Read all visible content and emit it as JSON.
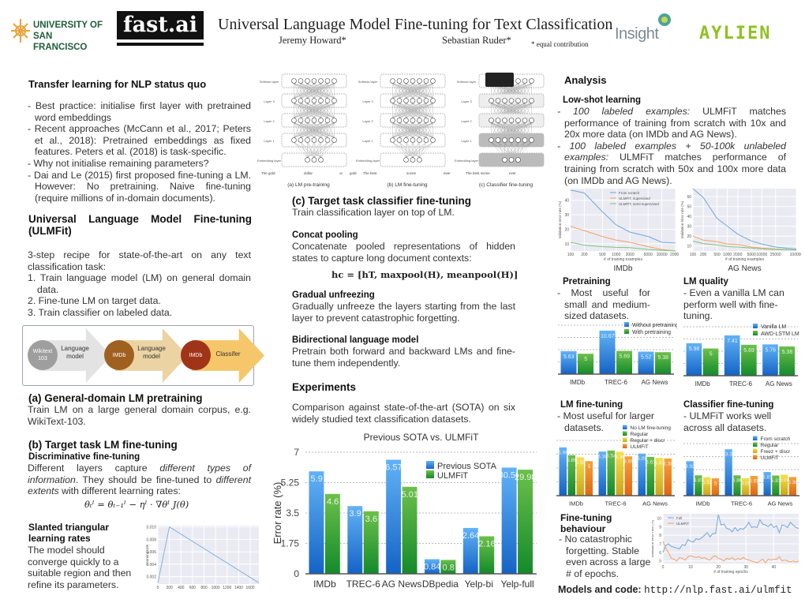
{
  "header": {
    "title": "Universal Language Model Fine-tuning for Text Classification",
    "author1": "Jeremy Howard*",
    "author2": "Sebastian Ruder*",
    "note": "* equal contribution",
    "logos": {
      "usf_line1": "UNIVERSITY OF",
      "usf_line2": "SAN FRANCISCO",
      "fastai": "fast.ai",
      "insight": "Insight",
      "aylien": "AYLIEN"
    }
  },
  "left": {
    "status_quo": {
      "heading": "Transfer learning for NLP status quo",
      "bullets": [
        "- Best practice: initialise first layer with pretrained word embeddings",
        "- Recent approaches (McCann et al., 2017; Peters et al., 2018): Pretrained embeddings as fixed features. Peters et al. (2018) is task-specific.",
        "- Why not initialise remaining parameters?",
        "- Dai and Le (2015) first proposed fine-tuning a LM. However: No pretraining. Naive fine-tuning (require millions of in-domain documents)."
      ]
    },
    "ulmfit": {
      "heading": "Universal Language Model Fine-tuning (ULMFit)",
      "intro": "3-step recipe for state-of-the-art on any text classification task:",
      "steps": [
        "1. Train language model (LM) on general domain data.",
        "2. Fine-tune LM on target data.",
        "3. Train classifier on labeled data."
      ]
    },
    "flow": [
      {
        "circle": "Wikitext 103",
        "label": "Language model",
        "circle_color": "#9e9e9e",
        "arrow_color": "#e3e3e3"
      },
      {
        "circle": "IMDb",
        "label": "Language model",
        "circle_color": "#a0601f",
        "arrow_color": "#ecd3a3"
      },
      {
        "circle": "IMDb",
        "label": "Classifer",
        "circle_color": "#a03418",
        "arrow_color": "#f5c76a"
      }
    ],
    "a": {
      "heading": "(a) General-domain LM pretraining",
      "text": "Train LM on a large general domain corpus, e.g. WikiText-103."
    },
    "b": {
      "heading": "(b) Target task LM fine-tuning",
      "sub": "Discriminative fine-tuning",
      "text_1": "Different layers capture ",
      "text_it1": "different types of information",
      "text_2": ". They should be fine-tuned to ",
      "text_it2": "different extents",
      "text_3": " with different learning rates:",
      "formula": "θₜˡ = θₜ₋₁ˡ − ηˡ · ∇θˡ J(θ)"
    },
    "stlr": {
      "heading": "Slanted triangular learning rates",
      "text": "The model should converge quickly to a suitable region and then refine its parameters."
    }
  },
  "middle": {
    "diagram": {
      "captions": [
        "(a) LM pre-training",
        "(b) LM fine-tuning",
        "(c) Classifier fine-tuning"
      ],
      "layers": [
        "Softmax layer",
        "Layer 3",
        "Layer 2",
        "Layer 1",
        "Embedding layer"
      ],
      "words": [
        "The gold",
        "dollar",
        "or",
        "gold",
        "The best",
        "scene",
        "ever",
        "The best scene",
        "ever"
      ]
    },
    "c": {
      "heading": "(c) Target task classifier fine-tuning",
      "text": "Train classification layer on top of LM."
    },
    "concat": {
      "heading": "Concat pooling",
      "text": "Concatenate pooled representations of hidden states to capture long document contexts:",
      "formula": "hc = [hT, maxpool(H), meanpool(H)]"
    },
    "gradual": {
      "heading": "Gradual unfreezing",
      "text": "Gradually unfreeze the layers starting from the last layer to prevent catastrophic forgetting."
    },
    "bidir": {
      "heading": "Bidirectional language model",
      "text": "Pretrain both forward and backward LMs and fine-tune them independently."
    },
    "experiments": {
      "heading": "Experiments",
      "text": "Comparison against state-of-the-art (SOTA) on six widely studied text classification datasets."
    }
  },
  "right": {
    "analysis": "Analysis",
    "lowshot": {
      "heading": "Low-shot learning",
      "b1_it": "- 100 labeled examples:",
      "b1": " ULMFiT matches performance of training from scratch with 10x and 20x more data (on IMDb and AG News).",
      "b2_it": "- 100 labeled examples + 50-100k unlabeled examples:",
      "b2": " ULMFiT matches performance of training from scratch with 50x and 100x more data (on IMDb and AG News)."
    },
    "pretraining": {
      "heading": "Pretraining",
      "text": "- Most useful for small and medium-sized datasets."
    },
    "lmquality": {
      "heading": "LM quality",
      "text": "- Even a vanilla LM can perform well with fine-tuning."
    },
    "lmft": {
      "heading": "LM fine-tuning",
      "text": "- Most useful for larger datasets."
    },
    "clsft": {
      "heading": "Classifier fine-tuning",
      "text": "- ULMFiT works well across all datasets."
    },
    "behaviour": {
      "heading": "Fine-tuning behaviour",
      "text": "- No catastrophic forgetting. Stable even across a large # of epochs."
    },
    "models": {
      "label": "Models and code:",
      "url": "http://nlp.fast.ai/ulmfit"
    }
  },
  "colors": {
    "blue": "#2f86df",
    "green": "#2e9e34",
    "yellow": "#e4c52a",
    "orange": "#ee8420"
  },
  "chart_data": [
    {
      "id": "sota",
      "type": "bar",
      "title": "Previous SOTA vs. ULMFiT",
      "ylabel": "Error rate (%)",
      "ylim": [
        0,
        7
      ],
      "yticks": [
        "0",
        "1.75",
        "3.5",
        "5.25",
        "7"
      ],
      "grid": true,
      "legend": "top-right",
      "categories": [
        "IMDb",
        "TREC-6",
        "AG News",
        "DBpedia",
        "Yelp-bi",
        "Yelp-full"
      ],
      "series": [
        {
          "name": "Previous SOTA",
          "values": [
            5.9,
            3.9,
            6.57,
            0.84,
            2.64,
            30.58
          ],
          "labels": [
            "5.9",
            "3.9",
            "6.57",
            "0.84",
            "2.64",
            "30.58"
          ],
          "color": "blue"
        },
        {
          "name": "ULMFiT",
          "values": [
            4.6,
            3.6,
            5.01,
            0.8,
            2.16,
            29.98
          ],
          "labels": [
            "4.6",
            "3.6",
            "5.01",
            "0.8",
            "2.16",
            "29.98"
          ],
          "color": "green"
        }
      ]
    },
    {
      "id": "pre",
      "type": "bar",
      "ylim": [
        0,
        12
      ],
      "grid": true,
      "legend": "top-right",
      "categories": [
        "IMDb",
        "TREC-6",
        "AG News"
      ],
      "series": [
        {
          "name": "Without pretraining",
          "values": [
            5.63,
            10.67,
            5.52
          ],
          "labels": [
            "5.63",
            "10.67",
            "5.52"
          ],
          "color": "blue"
        },
        {
          "name": "With pretraining",
          "values": [
            5,
            5.69,
            5.38
          ],
          "labels": [
            "5",
            "5.69",
            "5.38"
          ],
          "color": "green"
        }
      ]
    },
    {
      "id": "lmq",
      "type": "bar",
      "ylim": [
        0,
        9
      ],
      "grid": true,
      "legend": "top-right",
      "categories": [
        "IMDb",
        "TREC-6",
        "AG News"
      ],
      "series": [
        {
          "name": "Vanilla LM",
          "values": [
            5.98,
            7.41,
            5.76
          ],
          "labels": [
            "5.98",
            "7.41",
            "5.76"
          ],
          "color": "blue"
        },
        {
          "name": "AWD-LSTM LM",
          "values": [
            5,
            5.69,
            5.38
          ],
          "labels": [
            "5",
            "5.69",
            "5.38"
          ],
          "color": "green"
        }
      ]
    },
    {
      "id": "lmft",
      "type": "bar",
      "ylim": [
        0,
        8
      ],
      "grid": true,
      "legend": "top-right",
      "categories": [
        "IMDb",
        "TREC-6",
        "AG News"
      ],
      "series": [
        {
          "name": "No LM fine-tuning",
          "values": [
            6.99,
            6.38,
            6.09
          ],
          "labels": [
            "6.99",
            "6.38",
            "6.09"
          ],
          "color": "blue"
        },
        {
          "name": "Regular",
          "values": [
            5.86,
            6.54,
            5.61
          ],
          "labels": [
            "5.86",
            "6.54",
            "5.61"
          ],
          "color": "green"
        },
        {
          "name": "Regular + discr",
          "values": [
            5.55,
            6.36,
            5.47
          ],
          "labels": [
            "5.55",
            "6.36",
            "5.47"
          ],
          "color": "yellow"
        },
        {
          "name": "ULMFiT",
          "values": [
            5,
            5.69,
            5.38
          ],
          "labels": [
            "5",
            "5.69",
            "5.38"
          ],
          "color": "orange"
        }
      ]
    },
    {
      "id": "clsft",
      "type": "bar",
      "ylim": [
        0,
        15
      ],
      "grid": true,
      "legend": "top-right",
      "categories": [
        "IMDb",
        "TREC-6",
        "AG News"
      ],
      "series": [
        {
          "name": "From scratch",
          "values": [
            9.93,
            13.36,
            6.81
          ],
          "labels": [
            "9.93",
            "13.36",
            "6.81"
          ],
          "color": "blue"
        },
        {
          "name": "Regular",
          "values": [
            5.87,
            5.86,
            5.81
          ],
          "labels": [
            "5.87",
            "5.86",
            "5.81"
          ],
          "color": "green"
        },
        {
          "name": "Freez + discr",
          "values": [
            5.32,
            5.05,
            6.04
          ],
          "labels": [
            "5.32",
            "5.05",
            "6.04"
          ],
          "color": "yellow"
        },
        {
          "name": "ULMFiT",
          "values": [
            5,
            5.69,
            5.38
          ],
          "labels": [
            "5",
            "5.69",
            "5.38"
          ],
          "color": "orange"
        }
      ]
    },
    {
      "id": "imdb",
      "type": "line",
      "title": "IMDb",
      "xlabel": "# of training examples",
      "ylabel": "Validation error rate (%)",
      "xscale": "log",
      "ylim": [
        5,
        48
      ],
      "yticks": [
        "10",
        "20",
        "30",
        "40"
      ],
      "x": [
        100,
        200,
        500,
        1000,
        2000,
        5000,
        10000,
        20000
      ],
      "xticks": [
        "100",
        "200",
        "500",
        "1000",
        "2000",
        "5000",
        "10000",
        "20000"
      ],
      "series": [
        {
          "name": "From scratch",
          "values": [
            47,
            45,
            32,
            23,
            18,
            15,
            11,
            10.5
          ],
          "color": "#6fa8dc"
        },
        {
          "name": "ULMFiT, supervised",
          "values": [
            22,
            19,
            15,
            12.5,
            11,
            8,
            6,
            5
          ],
          "color": "#f4a261"
        },
        {
          "name": "ULMFiT, semi-supervised",
          "values": [
            11,
            9,
            8,
            7.5,
            7.3,
            6,
            5.5,
            5
          ],
          "color": "#7bc67e"
        }
      ]
    },
    {
      "id": "ag",
      "type": "line",
      "title": "AG News",
      "xlabel": "# of training examples",
      "ylabel": "Validation error rate (%)",
      "xscale": "log",
      "ylim": [
        5,
        68
      ],
      "yticks": [
        "10",
        "20",
        "30",
        "40",
        "50",
        "60"
      ],
      "x": [
        100,
        200,
        500,
        1000,
        2000,
        5000,
        10000,
        25000,
        100000
      ],
      "xticks": [
        "100",
        "200",
        "500",
        "1000",
        "2000",
        "5000",
        "10000",
        "25000",
        "100000"
      ],
      "series": [
        {
          "name": "From scratch",
          "values": [
            68,
            59,
            38,
            30,
            22,
            15,
            12,
            9,
            7
          ],
          "color": "#6fa8dc"
        },
        {
          "name": "ULMFiT, supervised",
          "values": [
            20,
            16,
            14.5,
            12,
            11.5,
            9,
            8,
            7,
            6
          ],
          "color": "#f4a261"
        },
        {
          "name": "ULMFiT, semi-supervised",
          "values": [
            15,
            12.5,
            11,
            9.5,
            9,
            8,
            7,
            6.5,
            6
          ],
          "color": "#7bc67e"
        }
      ]
    },
    {
      "id": "epochs",
      "type": "line",
      "xlabel": "# of training epochs",
      "ylabel": "Validation error rate (%)",
      "ylim": [
        4.7,
        10.5
      ],
      "yticks": [
        "5",
        "6",
        "7",
        "8",
        "9",
        "10"
      ],
      "xticks": [
        "0",
        "10",
        "20",
        "30",
        "40"
      ],
      "x": [
        0,
        1,
        2,
        3,
        4,
        5,
        6,
        7,
        8,
        9,
        10,
        11,
        12,
        13,
        14,
        15,
        16,
        17,
        18,
        19,
        20,
        21,
        22,
        23,
        24,
        25,
        26,
        27,
        28,
        29,
        30,
        31,
        32,
        33,
        34,
        35,
        36,
        37,
        38,
        39,
        40,
        41,
        42,
        43,
        44,
        45,
        46,
        47,
        48,
        49
      ],
      "series": [
        {
          "name": "Full",
          "values": [
            6.0,
            6.8,
            7.0,
            6.7,
            6.6,
            6.5,
            6.4,
            6.9,
            6.8,
            7.5,
            7.3,
            7.2,
            7.6,
            7.5,
            7.7,
            8.0,
            8.3,
            7.8,
            8.2,
            8.2,
            10.4,
            9.2,
            9.3,
            8.8,
            8.7,
            8.4,
            8.9,
            8.5,
            8.8,
            8.7,
            9.0,
            9.5,
            8.9,
            9.0,
            8.9,
            9.8,
            9.3,
            9.2,
            9.0,
            9.3,
            8.9,
            9.1,
            8.3,
            9.2,
            9.1,
            8.9,
            9.5,
            9.2,
            8.9,
            8.8
          ],
          "color": "#6fa8dc"
        },
        {
          "name": "ULMFiT",
          "values": [
            7.3,
            6.5,
            6.0,
            5.3,
            5.2,
            5.0,
            5.4,
            5.3,
            5.1,
            5.5,
            5.6,
            5.5,
            5.4,
            5.5,
            5.3,
            5.4,
            5.2,
            5.1,
            5.5,
            5.6,
            5.3,
            5.2,
            5.0,
            5.3,
            5.2,
            5.4,
            5.1,
            5.3,
            5.2,
            5.4,
            5.2,
            5.1,
            5.0,
            4.9,
            4.8,
            5.0,
            5.2,
            4.8,
            5.2,
            5.1,
            5.2,
            5.2,
            5.5,
            5.0,
            5.1,
            5.0,
            4.9,
            5.0,
            4.9,
            5.0
          ],
          "color": "#f4a261"
        }
      ]
    },
    {
      "id": "stlr",
      "type": "line",
      "ylabel": "Learning rate",
      "xticks": [
        "0",
        "200",
        "400",
        "600",
        "800",
        "1000",
        "1200",
        "1400",
        "1600"
      ],
      "yticks": [
        "0.002",
        "0.004",
        "0.006",
        "0.008",
        "0.010"
      ],
      "ylim": [
        0.0008,
        0.0102
      ],
      "x": [
        0,
        200,
        1750
      ],
      "series": [
        {
          "values": [
            0.001,
            0.01,
            0.001
          ],
          "color": "#7fb2de"
        }
      ]
    }
  ]
}
